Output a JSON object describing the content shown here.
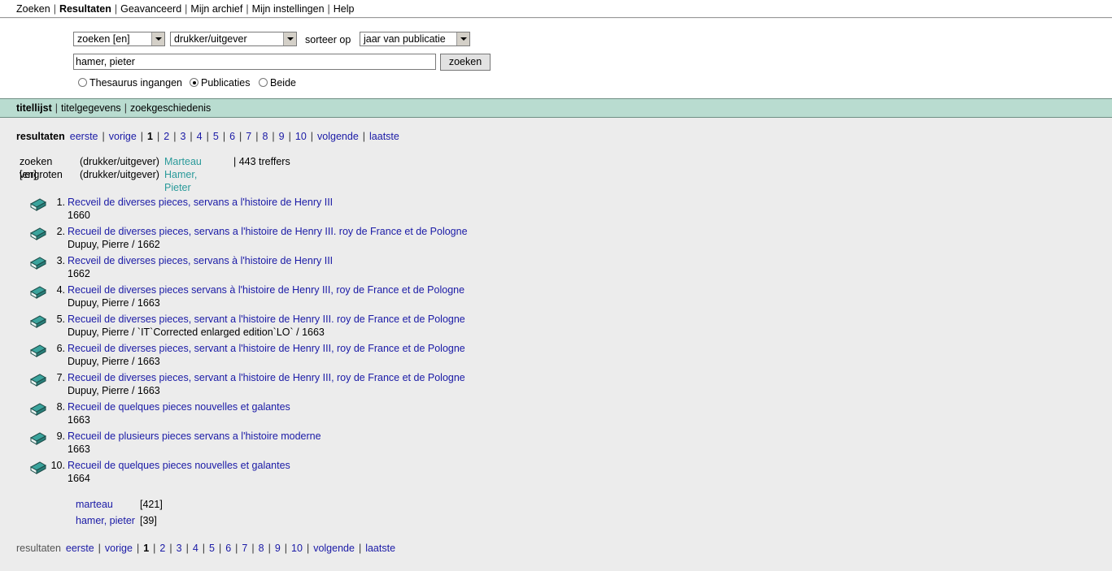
{
  "top_menu": {
    "items": [
      "Zoeken",
      "Resultaten",
      "Geavanceerd",
      "Mijn archief",
      "Mijn instellingen",
      "Help"
    ]
  },
  "search": {
    "scope_select": "zoeken [en]",
    "field_select": "drukker/uitgever",
    "sort_label": "sorteer op",
    "sort_select": "jaar van publicatie",
    "query_value": "hamer, pieter",
    "button_label": "zoeken",
    "radios": [
      {
        "label": "Thesaurus ingangen",
        "checked": false
      },
      {
        "label": "Publicaties",
        "checked": true
      },
      {
        "label": "Beide",
        "checked": false
      }
    ]
  },
  "tabs": [
    "titellijst",
    "titelgegevens",
    "zoekgeschiedenis"
  ],
  "pager": {
    "label": "resultaten",
    "first": "eerste",
    "prev": "vorige",
    "pages": [
      "1",
      "2",
      "3",
      "4",
      "5",
      "6",
      "7",
      "8",
      "9",
      "10"
    ],
    "current": "1",
    "next": "volgende",
    "last": "laatste"
  },
  "query_info": {
    "rows": [
      {
        "action": "zoeken [en]",
        "field": "(drukker/uitgever)",
        "term": "Marteau",
        "hits": "| 443 treffers"
      },
      {
        "action": "vergroten",
        "field": "(drukker/uitgever)",
        "term": "Hamer, Pieter",
        "hits": ""
      }
    ]
  },
  "results": [
    {
      "num": "1.",
      "title": "Recveil de diverses pieces, servans a l'histoire de Henry III",
      "sub": "1660"
    },
    {
      "num": "2.",
      "title": "Recueil de diverses pieces, servans a l'histoire de Henry III. roy de France et de Pologne",
      "sub": "Dupuy, Pierre / 1662"
    },
    {
      "num": "3.",
      "title": "Recveil de diverses pieces, servans à l'histoire de Henry III",
      "sub": "1662"
    },
    {
      "num": "4.",
      "title": "Recueil de diverses pieces servans à l'histoire de Henry III, roy de France et de Pologne",
      "sub": "Dupuy, Pierre / 1663"
    },
    {
      "num": "5.",
      "title": "Recueil de diverses pieces, servant a l'histoire de Henry III. roy de France et de Pologne",
      "sub": "Dupuy, Pierre / `IT`Corrected enlarged edition`LO` / 1663"
    },
    {
      "num": "6.",
      "title": "Recueil de diverses pieces, servant a l'histoire de Henry III, roy de France et de Pologne",
      "sub": "Dupuy, Pierre / 1663"
    },
    {
      "num": "7.",
      "title": "Recueil de diverses pieces, servant a l'histoire de Henry III, roy de France et de Pologne",
      "sub": "Dupuy, Pierre / 1663"
    },
    {
      "num": "8.",
      "title": "Recueil de quelques pieces nouvelles et galantes",
      "sub": "1663"
    },
    {
      "num": "9.",
      "title": "Recueil de plusieurs pieces servans a l'histoire moderne",
      "sub": "1663"
    },
    {
      "num": "10.",
      "title": "Recueil de quelques pieces nouvelles et galantes",
      "sub": "1664"
    }
  ],
  "facets": [
    {
      "name": "marteau",
      "count": "[421]"
    },
    {
      "name": "hamer, pieter",
      "count": "[39]"
    }
  ],
  "colors": {
    "tab_bar": "#b9dcd0",
    "link": "#1a1aa6",
    "query_term": "#2a9a9a",
    "book_icon": "#2f8f8a"
  }
}
